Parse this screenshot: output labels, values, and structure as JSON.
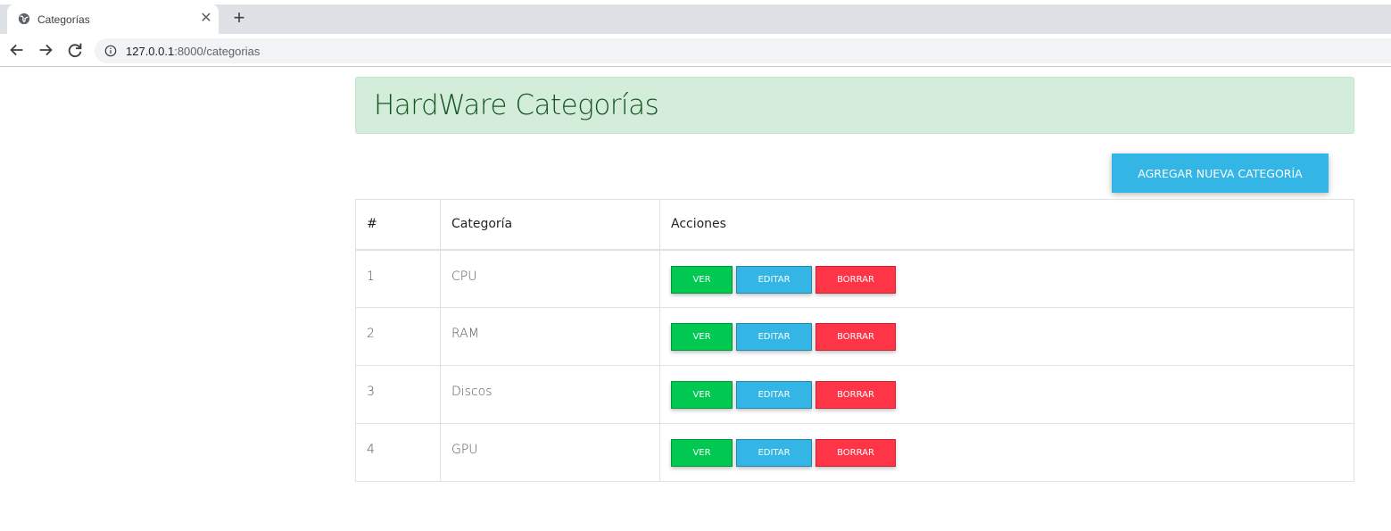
{
  "browser": {
    "tab_title": "Categorías",
    "url_host": "127.0.0.1",
    "url_rest": ":8000/categorias"
  },
  "page": {
    "heading": "HardWare Categorías",
    "add_button": "AGREGAR NUEVA CATEGORÍA",
    "table": {
      "headers": [
        "#",
        "Categoría",
        "Acciones"
      ],
      "rows": [
        {
          "id": "1",
          "name": "CPU"
        },
        {
          "id": "2",
          "name": "RAM"
        },
        {
          "id": "3",
          "name": "Discos"
        },
        {
          "id": "4",
          "name": "GPU"
        }
      ],
      "actions": {
        "view": "VER",
        "edit": "EDITAR",
        "delete": "BORRAR"
      }
    }
  },
  "colors": {
    "success": "#00c851",
    "info": "#33b5e5",
    "danger": "#ff3547",
    "alert_bg": "#d4edda",
    "alert_text": "#155724"
  }
}
